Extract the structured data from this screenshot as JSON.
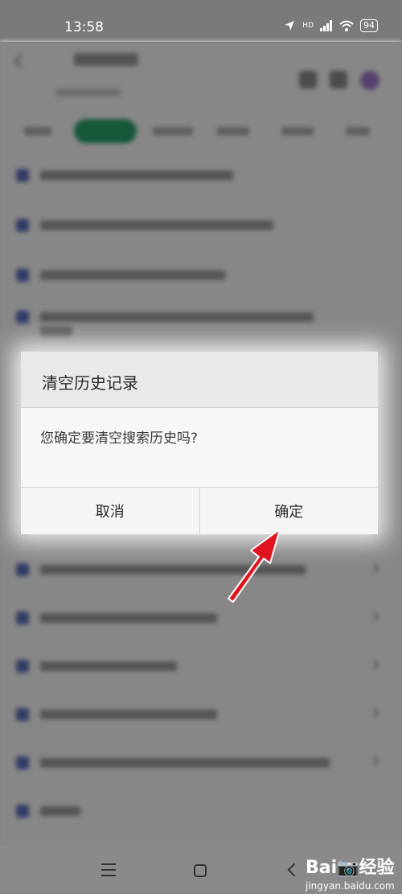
{
  "status_bar": {
    "time": "13:58",
    "battery": "94",
    "network": "HD"
  },
  "dialog": {
    "title": "清空历史记录",
    "message": "您确定要清空搜索历史吗?",
    "cancel_label": "取消",
    "confirm_label": "确定"
  },
  "navigation": {
    "menu_icon": "menu-icon",
    "home_icon": "home-icon",
    "back_icon": "back-icon"
  },
  "watermark": {
    "logo": "Bai📷经验",
    "url": "jingyan.baidu.com"
  },
  "colors": {
    "annotation_arrow": "#e0141e",
    "accent_tab": "#29a06b"
  }
}
